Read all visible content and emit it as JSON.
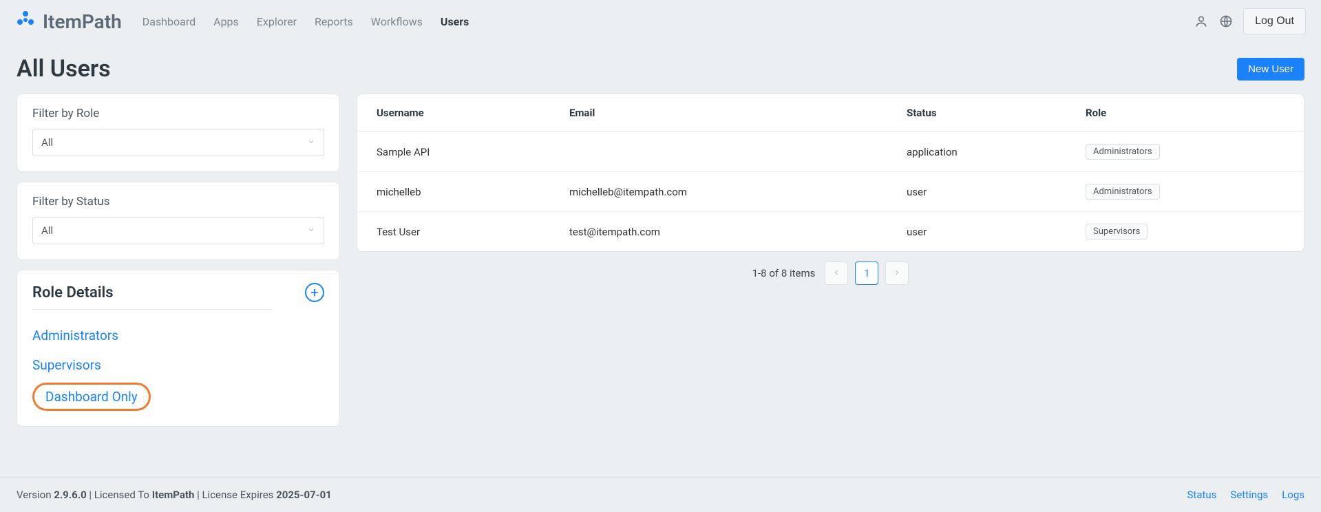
{
  "brand": "ItemPath",
  "nav": {
    "items": [
      {
        "label": "Dashboard",
        "active": false
      },
      {
        "label": "Apps",
        "active": false
      },
      {
        "label": "Explorer",
        "active": false
      },
      {
        "label": "Reports",
        "active": false
      },
      {
        "label": "Workflows",
        "active": false
      },
      {
        "label": "Users",
        "active": true
      }
    ],
    "logout": "Log Out"
  },
  "page": {
    "title": "All Users",
    "new_user_btn": "New User"
  },
  "filters": {
    "role_label": "Filter by Role",
    "role_value": "All",
    "status_label": "Filter by Status",
    "status_value": "All"
  },
  "roles_panel": {
    "heading": "Role Details",
    "items": [
      "Administrators",
      "Supervisors",
      "Dashboard Only"
    ],
    "highlighted": "Dashboard Only"
  },
  "table": {
    "columns": [
      "Username",
      "Email",
      "Status",
      "Role"
    ],
    "rows": [
      {
        "username": "Sample API",
        "email": "",
        "status": "application",
        "role": "Administrators"
      },
      {
        "username": "michelleb",
        "email": "michelleb@itempath.com",
        "status": "user",
        "role": "Administrators"
      },
      {
        "username": "Test User",
        "email": "test@itempath.com",
        "status": "user",
        "role": "Supervisors"
      }
    ]
  },
  "pagination": {
    "range_text": "1-8 of 8 items",
    "current_page": "1"
  },
  "footer": {
    "version_label": "Version ",
    "version": "2.9.6.0",
    "sep1": " | Licensed To ",
    "licensed_to": "ItemPath",
    "sep2": " | License Expires ",
    "expires": "2025-07-01",
    "links": [
      "Status",
      "Settings",
      "Logs"
    ]
  }
}
